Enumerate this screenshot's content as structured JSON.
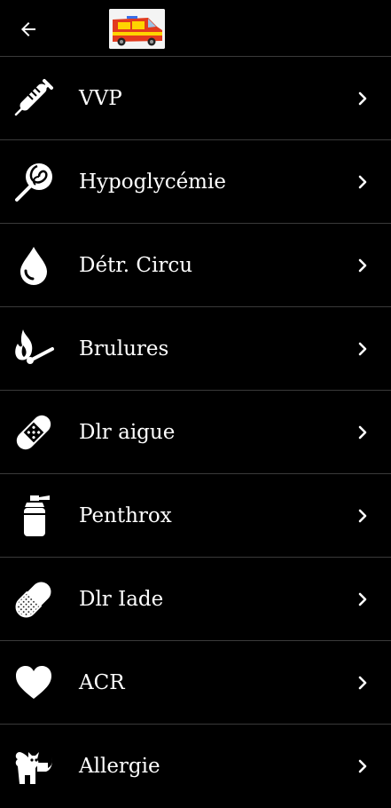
{
  "header": {
    "back_icon": "arrow-left-icon",
    "logo_icon": "ambulance-van-logo"
  },
  "menu": {
    "items": [
      {
        "label": "VVP",
        "icon": "syringe-icon"
      },
      {
        "label": "Hypoglycémie",
        "icon": "lollipop-icon"
      },
      {
        "label": "Détr. Circu",
        "icon": "blood-drop-icon"
      },
      {
        "label": "Brulures",
        "icon": "match-flame-icon"
      },
      {
        "label": "Dlr aigue",
        "icon": "bandage-icon"
      },
      {
        "label": "Penthrox",
        "icon": "spray-can-icon"
      },
      {
        "label": "Dlr Iade",
        "icon": "pill-capsule-icon"
      },
      {
        "label": "ACR",
        "icon": "heart-icon"
      },
      {
        "label": "Allergie",
        "icon": "cat-icon"
      }
    ],
    "chevron_icon": "chevron-right-icon"
  },
  "colors": {
    "background": "#000000",
    "text": "#ffffff",
    "divider": "#3a3a3a"
  }
}
